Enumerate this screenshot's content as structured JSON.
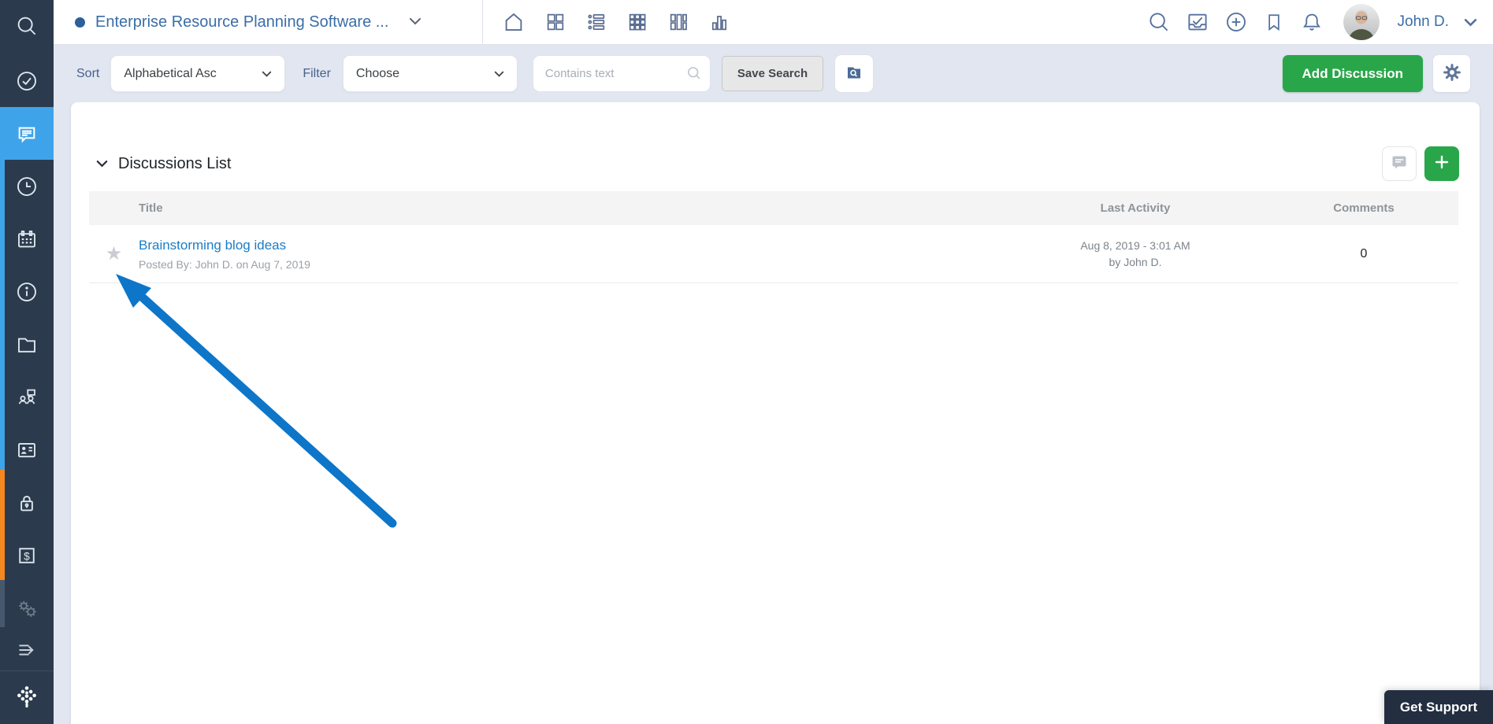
{
  "window": {
    "title": "Enterprise Resource Planning Software ..."
  },
  "topbar": {
    "view_icons": [
      "home",
      "dashboard-grid",
      "list-view",
      "grid-view",
      "column-view",
      "chart-view"
    ],
    "right_icons": [
      "search",
      "approvals",
      "add",
      "bookmarks",
      "notifications"
    ],
    "user": {
      "name": "John D."
    }
  },
  "sidebar": {
    "items": [
      "search",
      "tasks",
      "discussions",
      "time",
      "calendar",
      "info",
      "documents",
      "workspaces",
      "contacts",
      "security",
      "expenses",
      "settings"
    ],
    "active_item": "discussions"
  },
  "filters": {
    "sort_label": "Sort",
    "sort_value": "Alphabetical Asc",
    "filter_label": "Filter",
    "filter_value": "Choose",
    "search_placeholder": "Contains text",
    "save_search_label": "Save Search",
    "add_button_label": "Add Discussion"
  },
  "discussions": {
    "section_title": "Discussions List",
    "columns": [
      "Title",
      "Last Activity",
      "Comments"
    ],
    "rows": [
      {
        "title": "Brainstorming blog ideas",
        "posted_by": "Posted By: John D. on Aug 7, 2019",
        "last_activity_date": "Aug 8, 2019 - 3:01 AM",
        "last_activity_by": "by John D.",
        "comments": "0"
      }
    ]
  },
  "support": {
    "label": "Get Support"
  },
  "icons": {
    "star": "★"
  },
  "colors": {
    "sidebar-bg": "#2b3b4d",
    "active-blue": "#3fa3ea",
    "strip-orange": "#f6871f",
    "strip-slate": "#46586c",
    "page-bg": "#e2e6f1",
    "title-blue": "#3a6da7",
    "icon-slate": "#5b6d92",
    "green": "#2aa64a",
    "link-blue": "#1b7dc7",
    "arrow-blue": "#0d76c9",
    "support-bg": "#232e40"
  }
}
